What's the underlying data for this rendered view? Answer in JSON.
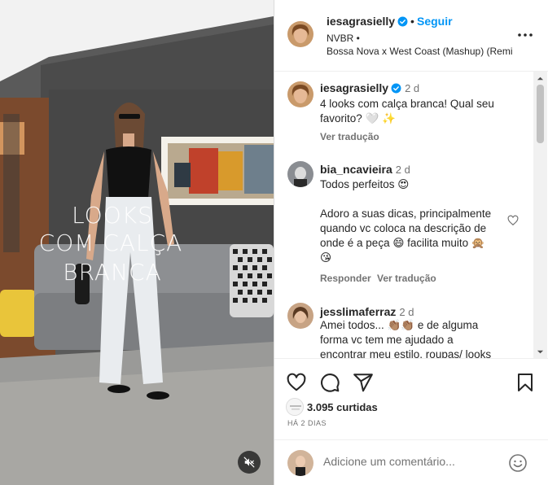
{
  "media": {
    "overlay_lines": [
      "LOOKS",
      "COM CALÇA",
      "BRANCA"
    ],
    "mute_icon": "speaker-muted-icon"
  },
  "header": {
    "username": "iesagrasielly",
    "separator": "•",
    "follow_label": "Seguir",
    "subtitle": "NVBR •",
    "audio": "Bossa Nova x West Coast (Mashup) (Remi",
    "more_icon": "more-horizontal-icon"
  },
  "comments": [
    {
      "user": "iesagrasielly",
      "time": "2 d",
      "text_lines": [
        "4 looks com calça branca! Qual seu",
        "favorito? 🤍 ✨"
      ],
      "translate": "Ver tradução"
    },
    {
      "user": "bia_ncavieira",
      "time": "2 d",
      "text_lines": [
        "Todos perfeitos 😍",
        "",
        "Adoro a suas dicas, principalmente",
        "quando vc coloca na descrição de",
        "onde é a peça 😄 facilita muito 🙊",
        "😘"
      ],
      "reply": "Responder",
      "translate": "Ver tradução"
    },
    {
      "user": "jesslimaferraz",
      "time": "2 d",
      "text_lines": [
        "Amei todos... 👏🏽👏🏽 e de alguma",
        "forma vc tem me ajudado a",
        "encontrar meu estilo, roupas/ looks"
      ]
    }
  ],
  "actions": {
    "likes": "3.095 curtidas",
    "ago": "HÁ 2 DIAS"
  },
  "composer": {
    "placeholder": "Adicione um comentário..."
  },
  "colors": {
    "accent": "#0095f6",
    "text": "#262626",
    "muted": "#737373",
    "border": "#dbdbdb"
  }
}
